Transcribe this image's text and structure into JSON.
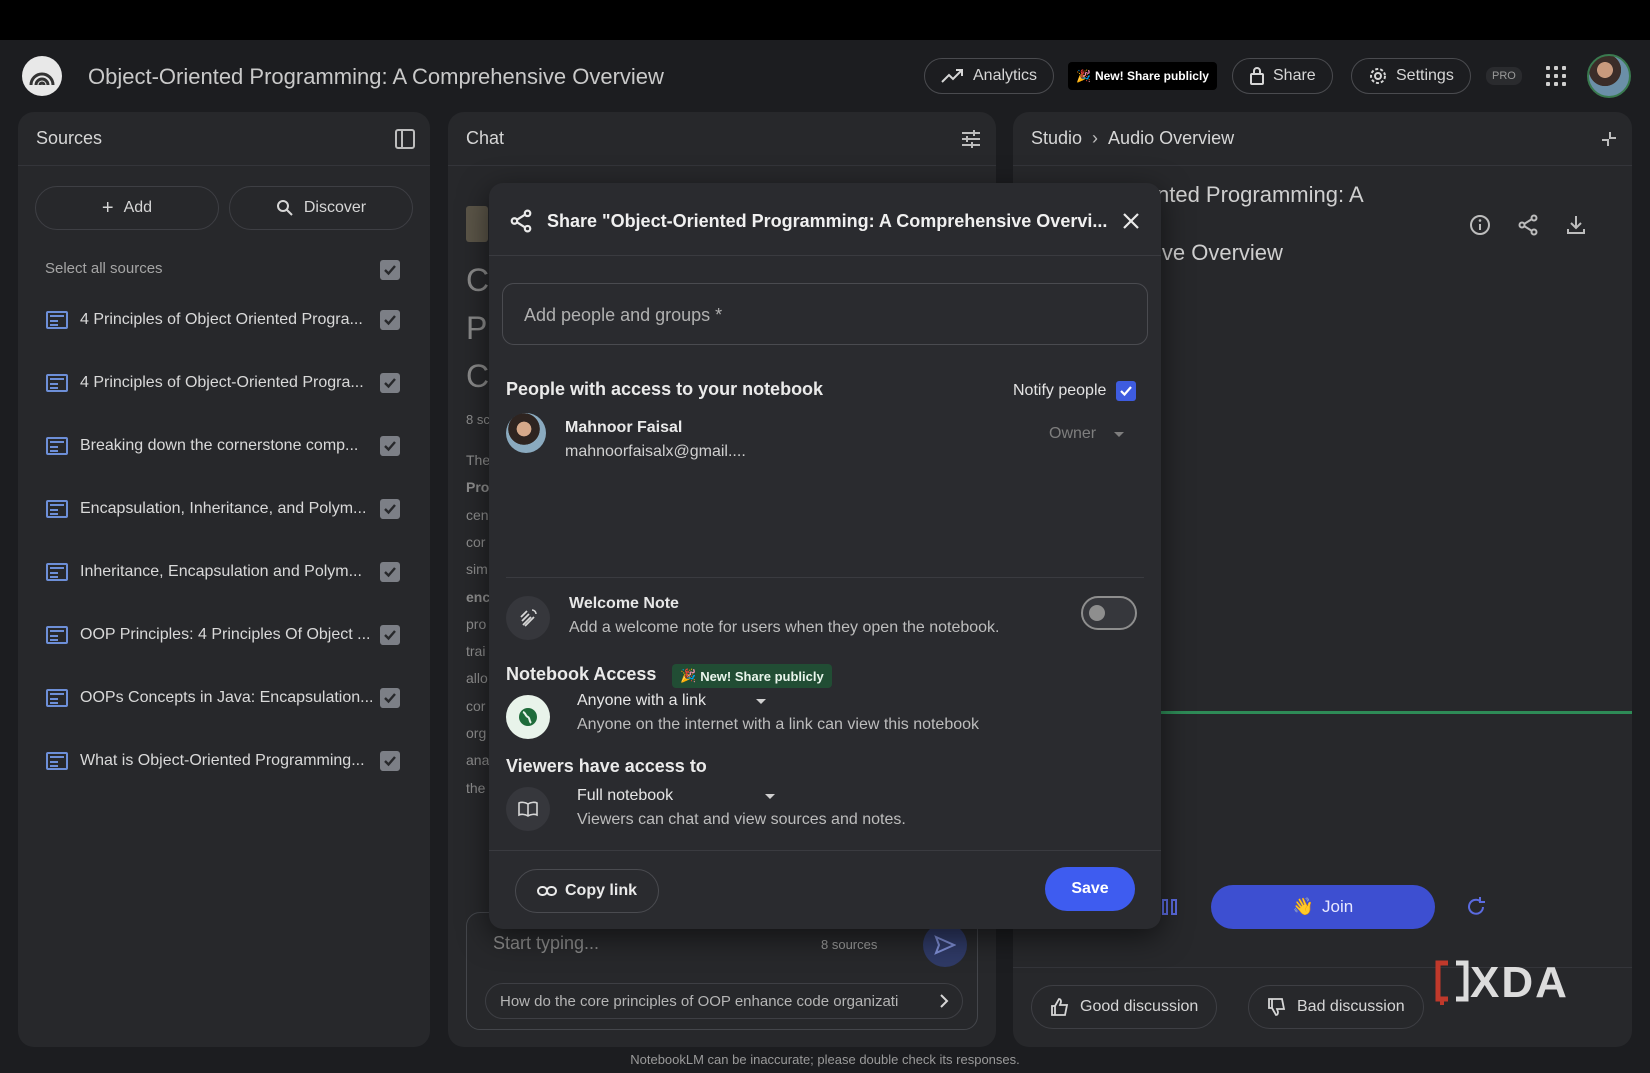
{
  "header": {
    "notebook_title": "Object-Oriented Programming: A Comprehensive Overview",
    "analytics_label": "Analytics",
    "new_share_badge": "New! Share publicly",
    "share_label": "Share",
    "settings_label": "Settings",
    "pro_label": "PRO"
  },
  "sources": {
    "title": "Sources",
    "add_label": "Add",
    "discover_label": "Discover",
    "select_all_label": "Select all sources",
    "items": [
      {
        "label": "4 Principles of Object Oriented Progra...",
        "checked": true
      },
      {
        "label": "4 Principles of Object-Oriented Progra...",
        "checked": true
      },
      {
        "label": "Breaking down the cornerstone comp...",
        "checked": true
      },
      {
        "label": "Encapsulation, Inheritance, and Polym...",
        "checked": true
      },
      {
        "label": "Inheritance, Encapsulation and Polym...",
        "checked": true
      },
      {
        "label": "OOP Principles: 4 Principles Of Object ...",
        "checked": true
      },
      {
        "label": "OOPs Concepts in Java: Encapsulation...",
        "checked": true
      },
      {
        "label": "What is Object-Oriented Programming...",
        "checked": true
      }
    ]
  },
  "chat": {
    "title": "Chat",
    "frag_big": [
      "C",
      "P",
      "C"
    ],
    "frag_count": "8 sc",
    "frag_lines": [
      "The",
      "Pro",
      "cen",
      "cor",
      "sim",
      "enc",
      "pro",
      "trai",
      "allo",
      "cor",
      "org",
      "ana",
      "the"
    ],
    "input_placeholder": "Start typing...",
    "source_count": "8 sources",
    "suggestion": "How do the core principles of OOP enhance code organizati"
  },
  "studio": {
    "breadcrumb_root": "Studio",
    "breadcrumb_current": "Audio Overview",
    "title_line1": "nted Programming: A",
    "title_line2": "ive Overview",
    "join_label": "Join",
    "good_label": "Good discussion",
    "bad_label": "Bad discussion"
  },
  "modal": {
    "title": "Share \"Object-Oriented Programming: A Comprehensive Overvi...",
    "add_people_placeholder": "Add people and groups *",
    "access_heading": "People with access to your notebook",
    "notify_label": "Notify people",
    "notify_checked": true,
    "person_name": "Mahnoor Faisal",
    "person_email": "mahnoorfaisalx@gmail....",
    "person_role": "Owner",
    "welcome_title": "Welcome Note",
    "welcome_desc": "Add a welcome note for users when they open the notebook.",
    "welcome_enabled": false,
    "notebook_access_heading": "Notebook Access",
    "new_share_chip": "New! Share publicly",
    "access_option": "Anyone with a link",
    "access_desc": "Anyone on the internet with a link can view this notebook",
    "viewers_heading": "Viewers have access to",
    "viewers_option": "Full notebook",
    "viewers_desc": "Viewers can chat and view sources and notes.",
    "copy_link_label": "Copy link",
    "save_label": "Save"
  },
  "watermark": "XDA",
  "footer": "NotebookLM can be inaccurate; please double check its responses.",
  "colors": {
    "accent": "#3e5cf0",
    "join": "#3d4fd1",
    "background": "#1c1d20",
    "panel": "#27282b",
    "progress": "#2e8b57"
  }
}
